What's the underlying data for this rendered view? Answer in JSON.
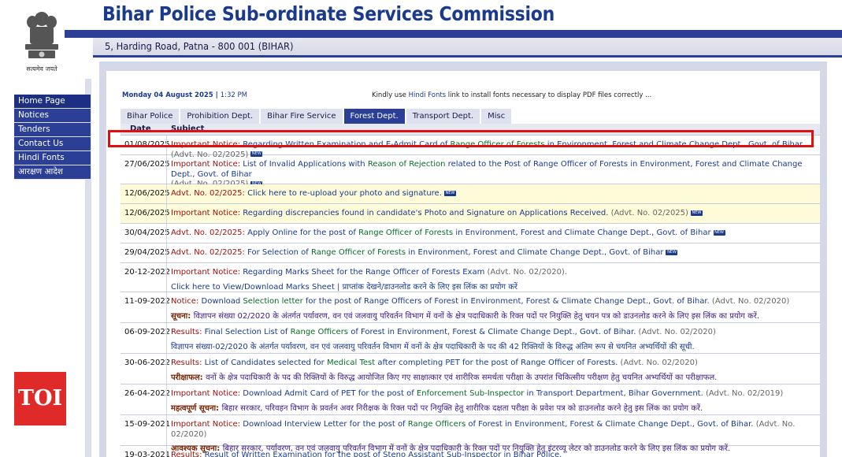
{
  "header": {
    "title": "Bihar Police Sub-ordinate Services Commission",
    "address": "5, Harding Road, Patna - 800 001 (BIHAR)",
    "emblem_caption": "सत्यमेव जयते"
  },
  "sidebar": {
    "items": [
      {
        "label": "Home Page"
      },
      {
        "label": "Notices"
      },
      {
        "label": "Tenders"
      },
      {
        "label": "Contact Us"
      },
      {
        "label": "Hindi Fonts"
      },
      {
        "label": "आरक्षण आदेश"
      }
    ]
  },
  "topbar": {
    "date": "Monday 04 August 2025",
    "time": "1:32 PM",
    "font_note_prefix": "Kindly use ",
    "font_note_link": "Hindi Fonts",
    "font_note_suffix": " link to install fonts necessary to display PDF files correctly ..."
  },
  "tabs": [
    {
      "label": "Bihar Police",
      "active": false
    },
    {
      "label": "Prohibition Dept.",
      "active": false
    },
    {
      "label": "Bihar Fire Service",
      "active": false
    },
    {
      "label": "Forest Dept.",
      "active": true
    },
    {
      "label": "Transport Dept.",
      "active": false
    },
    {
      "label": "Misc",
      "active": false
    }
  ],
  "table": {
    "headers": {
      "date": "Date",
      "subject": "Subject"
    },
    "new_badge": "NEW",
    "rows": [
      {
        "date": "01/08/2025",
        "p1": "Important Notice: ",
        "p2": "Regarding Written Examination and E-Admit Card of ",
        "p3": "Range Officer of Forests",
        "p4": " in Environment, Forest and Climate Change Dept., Govt. of Bihar ",
        "p5": "(Advt. No. 02/2025)"
      },
      {
        "date": "27/06/2025",
        "p1": "Important Notice: ",
        "p2": "List of Invalid Applications with ",
        "p3": "Reason of Rejection",
        "p4": " related to the Post of Range Officer of Forests in Environment, Forest and Climate Change Dept., Govt. of Bihar",
        "p5": "(Advt. No. 02/2025)"
      },
      {
        "date": "12/06/2025",
        "p1": "Advt. No. 02/2025: ",
        "p2": "Click here to re-upload your photo and signature."
      },
      {
        "date": "12/06/2025",
        "p1": "Important Notice: ",
        "p2": "Regarding discrepancies found in candidate's Photo and Signature on Applications Received. ",
        "p5": "(Advt. No. 02/2025)"
      },
      {
        "date": "30/04/2025",
        "p1": "Advt. No. 02/2025: ",
        "p2": "Apply Online for the post of ",
        "p3": "Range Officer of Forests",
        "p4": " in Environment, Forest and Climate Change Dept., Govt. of Bihar"
      },
      {
        "date": "29/04/2025",
        "p1": "Advt. No. 02/2025: ",
        "p2": "For Selection of ",
        "p3": "Range Officer of Forests",
        "p4": " in Environment, Forest and Climate Change Dept., Govt. of Bihar"
      },
      {
        "date": "20-12-2022",
        "p1": "Important Notice: ",
        "p2": "Regarding Marks Sheet for the Range Officer of Forests Exam ",
        "p5": "(Advt. No. 02/2020).",
        "line2": "Click here to View/Download Marks Sheet | प्राप्तांक देखने/डाउनलोड करने के लिए इस लिंक का प्रयोग करें"
      },
      {
        "date": "11-09-2022",
        "p1": "Notice: ",
        "p2": "Download ",
        "p3": "Selection letter",
        "p4": " for the post of Range Officers of Forest in Environment, Forest & Climate Change Dept., Govt. of Bihar. ",
        "p5": "(Advt. No. 02/2020)",
        "line2_hi": "सूचना: ",
        "line2": "विज्ञापन संख्या 02/2020 के अंतर्गत पर्यावरण, वन एवं जलवायु परिवर्तन विभाग में वनों के क्षेत्र पदाधिकारी के रिक्त पदों पर नियुक्ति हेतु चयन पत्र को डाउनलोड करने के लिए इस लिंक का प्रयोग करें."
      },
      {
        "date": "06-09-2022",
        "p1": "Results: ",
        "p2": "Final Selection List of ",
        "p3": "Range Officers",
        "p4": " of Forest in Environment, Forest & Climate Change Dept., Govt. of Bihar. ",
        "p5": "(Advt. No. 02/2020)",
        "line2": "विज्ञापन संख्या-02/2020 के अंतर्गत पर्यावरण, वन एवं जलवायु परिवर्तन विभाग में वनों के क्षेत्र पदाधिकारी के पद की 42 रिक्तियों के विरुद्ध अंतिम रूप से चयनित अभ्यर्थियों की सूची."
      },
      {
        "date": "30-06-2022",
        "p1": "Results: ",
        "p2": "List of Candidates selected for ",
        "p3": "Medical Test",
        "p4": " after completing PET for the post of Range Officer of Forests. ",
        "p5": "(Advt. No. 02/2020)",
        "line2_hi": "परीक्षाफल: ",
        "line2": "वनों के क्षेत्र पदाधिकारी के पद की रिक्तियों के विरुद्ध आयोजित किए गए साक्षात्कार एवं शारीरिक समर्थता परीक्षा के उपरांत चिकित्सीय परीक्षण हेतु चयनित अभ्यर्थियों का परीक्षाफल."
      },
      {
        "date": "26-04-2022",
        "p1": "Important Notice: ",
        "p2": "Download Admit Card of PET for the post of ",
        "p3": "Enforcement Sub-Inspector",
        "p4": " in Transport Department, Bihar Government. ",
        "p5": "(Advt. No. 02/2019)",
        "line2_hi": "महत्वपूर्ण सूचना: ",
        "line2": "बिहार सरकार, परिवहन विभाग के प्रवर्तन अवर निरीक्षक के रिक्त पदों पर नियुक्ति हेतु शारीरिक दक्षता परीक्षा के प्रवेश पत्र को डाउनलोड करने हेतु इस लिंक का प्रयोग करें."
      },
      {
        "date": "15-09-2021",
        "p1": "Important Notice: ",
        "p2": "Download Interview Letter for the post of ",
        "p3": "Range Officers",
        "p4": " of Forest in Environment, Forest & Climate Change Dept., Govt. of Bihar. ",
        "p5": "(Advt. No. 02/2020)",
        "line2_hi": "आवश्यक सूचना: ",
        "line2": "बिहार सरकार, पर्यावरण, वन एवं जलवायु परिवर्तन विभाग में वनों के क्षेत्र पदाधिकारी के रिक्त पदों पर नियुक्ति हेतु इंटरव्यू लेटर को डाउनलोड करने के लिए इस लिंक का प्रयोग करें."
      },
      {
        "date": "19-03-2021",
        "p1": "Results: ",
        "p2": "Result of Written Examination for the post of Steno Assistant Sub-Inspector in Bihar Police."
      }
    ]
  },
  "watermark": {
    "label": "TOI"
  },
  "colors": {
    "brand": "#2b3f96",
    "highlight": "#e01010",
    "toi": "#e02a2a"
  }
}
